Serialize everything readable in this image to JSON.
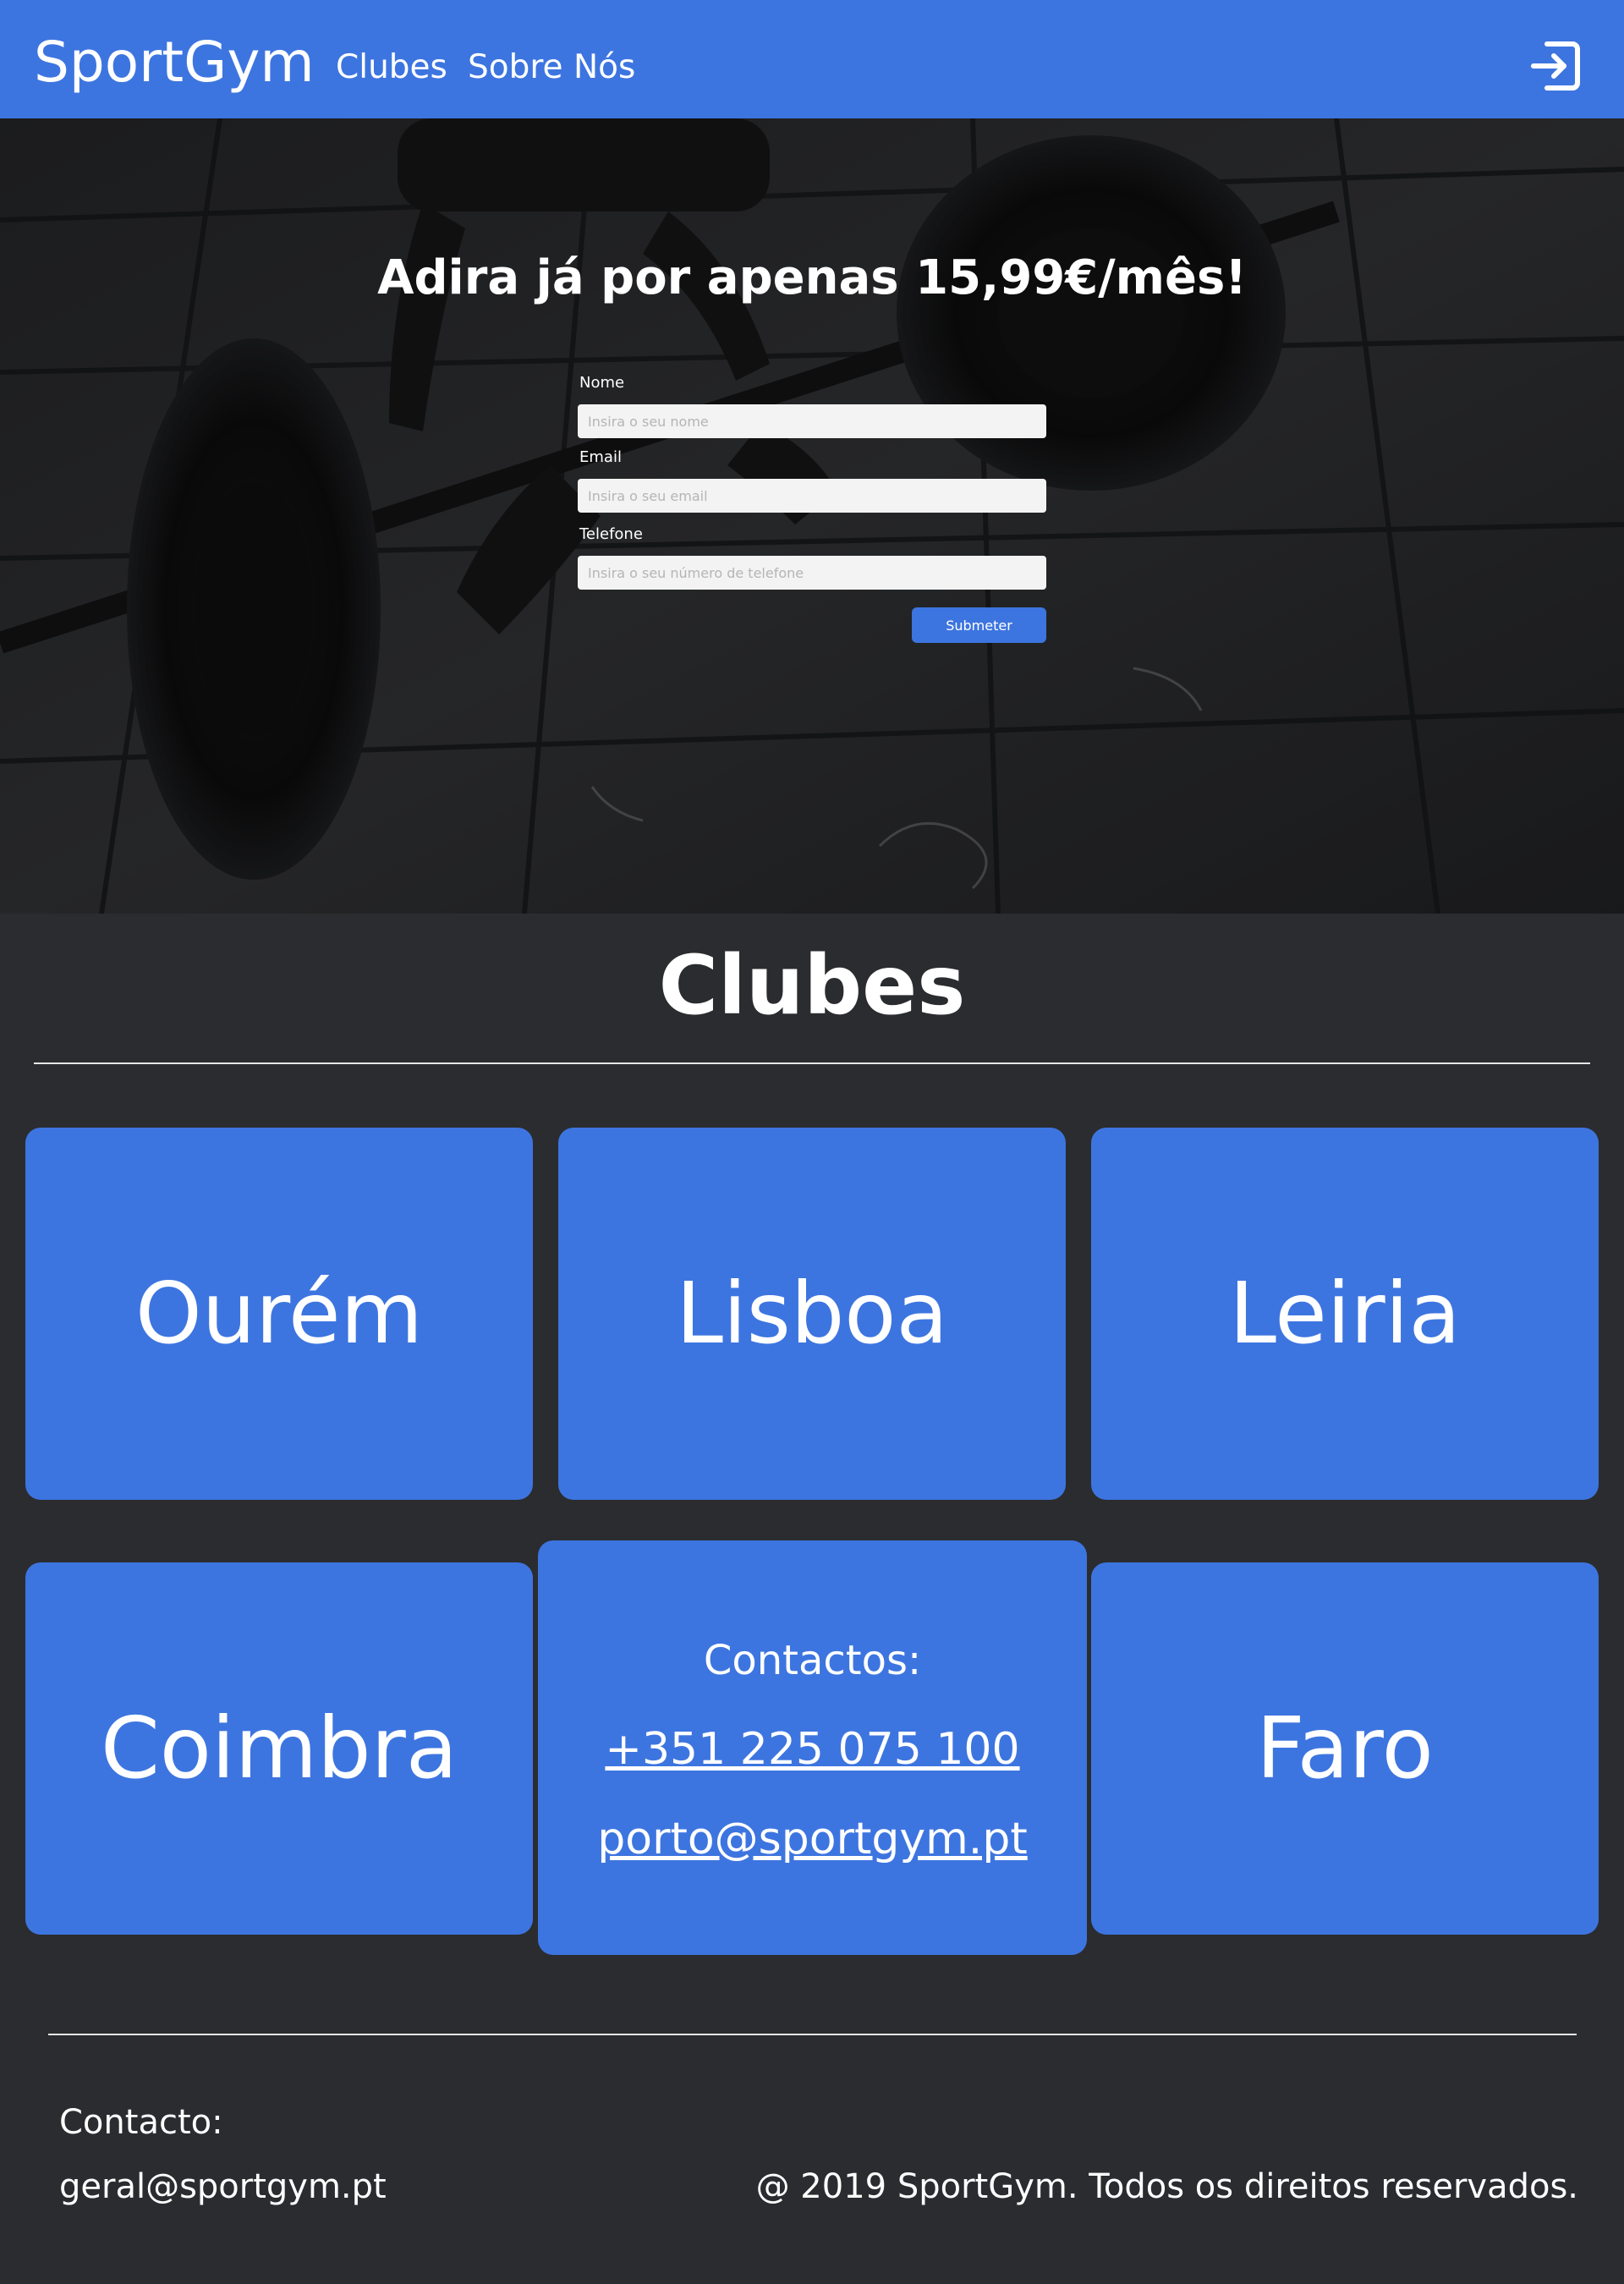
{
  "navbar": {
    "brand": "SportGym",
    "links": [
      "Clubes",
      "Sobre Nós"
    ],
    "login_icon": "login-arrow-icon",
    "color": "#3d75e0"
  },
  "hero": {
    "title": "Adira já por apenas 15,99€/mês!",
    "background": "dark-weightlifting-photo",
    "form": {
      "name_label": "Nome",
      "name_placeholder": "Insira o seu nome",
      "email_label": "Email",
      "email_placeholder": "Insira o seu email",
      "phone_label": "Telefone",
      "phone_placeholder": "Insira o seu número de telefone",
      "submit_label": "Submeter"
    }
  },
  "clubes": {
    "title": "Clubes",
    "cards": [
      "Ourém",
      "Lisboa",
      "Leiria",
      "Coimbra",
      "Faro"
    ],
    "contact_card": {
      "heading": "Contactos:",
      "phone": "+351 225 075 100",
      "email": "porto@sportgym.pt"
    }
  },
  "footer": {
    "contact_label": "Contacto:",
    "email": "geral@sportgym.pt",
    "copyright": "@ 2019 SportGym. Todos os direitos reservados."
  },
  "colors": {
    "accent": "#3d75e0",
    "background": "#2b2c2f",
    "text": "#ffffff"
  }
}
